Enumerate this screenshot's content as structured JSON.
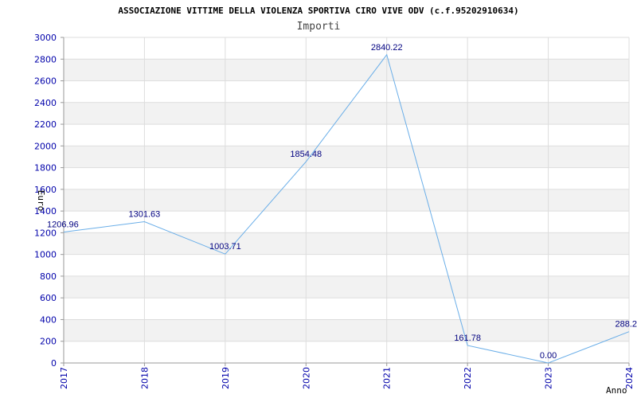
{
  "title": "ASSOCIAZIONE VITTIME DELLA VIOLENZA SPORTIVA CIRO VIVE ODV (c.f.95202910634)",
  "subtitle": "Importi",
  "colors": {
    "line": "#6aaee8",
    "band": "#f2f2f2",
    "grid": "#dddddd",
    "tick_text": "#0000aa",
    "label_text": "#000080"
  },
  "chart_data": {
    "type": "line",
    "title": "ASSOCIAZIONE VITTIME DELLA VIOLENZA SPORTIVA CIRO VIVE ODV (c.f.95202910634)",
    "subtitle": "Importi",
    "xlabel": "Anno",
    "ylabel": "Euro",
    "categories": [
      "2017",
      "2018",
      "2019",
      "2020",
      "2021",
      "2022",
      "2023",
      "2024"
    ],
    "values": [
      1206.96,
      1301.63,
      1003.71,
      1854.48,
      2840.22,
      161.78,
      0.0,
      288.2
    ],
    "value_labels": [
      "1206.96",
      "1301.63",
      "1003.71",
      "1854.48",
      "2840.22",
      "161.78",
      "0.00",
      "288.2"
    ],
    "ylim": [
      0,
      3000
    ],
    "yticks": [
      "0",
      "200",
      "400",
      "600",
      "800",
      "1000",
      "1200",
      "1400",
      "1600",
      "1800",
      "2000",
      "2200",
      "2400",
      "2600",
      "2800",
      "3000"
    ],
    "grid": true,
    "alternating_bands": true,
    "legend": "none"
  }
}
